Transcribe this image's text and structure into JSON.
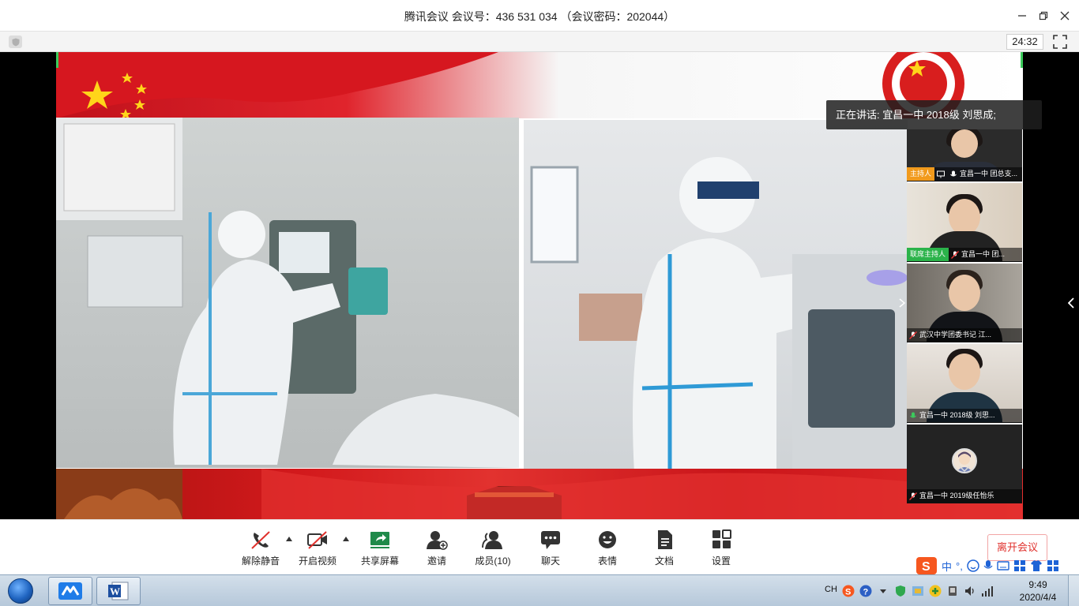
{
  "window": {
    "title": "腾讯会议  会议号：436 531 034 （会议密码：202044）",
    "timer": "24:32"
  },
  "speaker": {
    "text": "正在讲话: 宜昌一中 2018级 刘思成;"
  },
  "participants": [
    {
      "tag": "主持人",
      "tag_color": "#f19a1c",
      "name": "宜昌一中 团总支..."
    },
    {
      "tag": "联席主持人",
      "tag_color": "#2bb34a",
      "name": "宜昌一中 团..."
    },
    {
      "tag": "",
      "tag_color": "",
      "name": "武汉中学团委书记 江..."
    },
    {
      "tag": "",
      "tag_color": "",
      "name": "宜昌一中 2018级 刘思..."
    },
    {
      "tag": "",
      "tag_color": "",
      "name": "宜昌一中 2019级任怡乐"
    }
  ],
  "toolbar": {
    "unmute": "解除静音",
    "video": "开启视频",
    "share": "共享屏幕",
    "invite": "邀请",
    "members": "成员(10)",
    "chat": "聊天",
    "emoji": "表情",
    "doc": "文档",
    "settings": "设置",
    "leave": "离开会议"
  },
  "ime": {
    "lang": "中",
    "punct": "°,"
  },
  "taskbar": {
    "ch": "CH",
    "time": "9:49",
    "date": "2020/4/4"
  },
  "colors": {
    "accent_red": "#e0302c",
    "speaker_bg": "#1e1e1e",
    "tag_host": "#f19a1c",
    "tag_cohost": "#2bb34a"
  }
}
